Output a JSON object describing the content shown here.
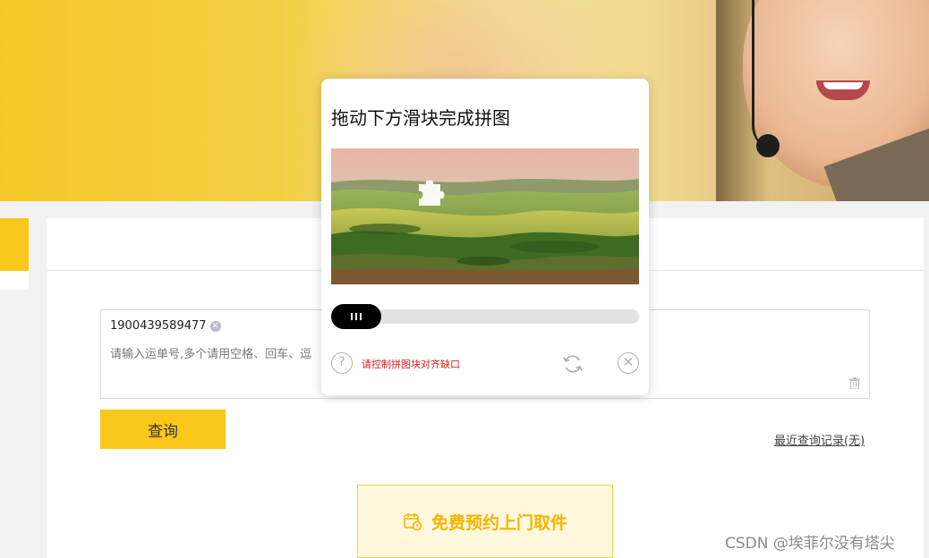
{
  "captcha": {
    "title": "拖动下方滑块完成拼图",
    "hint": "请控制拼图块对齐缺口",
    "slider_progress": 0,
    "help_symbol": "?",
    "close_symbol": "✕"
  },
  "waybill_input": {
    "tag_value": "1900439589477",
    "tag_remove_symbol": "✕",
    "placeholder": "请输入运单号,多个请用空格、回车、逗"
  },
  "actions": {
    "query_label": "查询",
    "recent_label": "最近查询记录(无)",
    "pickup_label": "免费预约上门取件"
  },
  "watermark": "CSDN @埃菲尔没有塔尖",
  "colors": {
    "accent": "#fac81a",
    "pickup_text": "#f5b400",
    "hint_red": "#e02020"
  }
}
